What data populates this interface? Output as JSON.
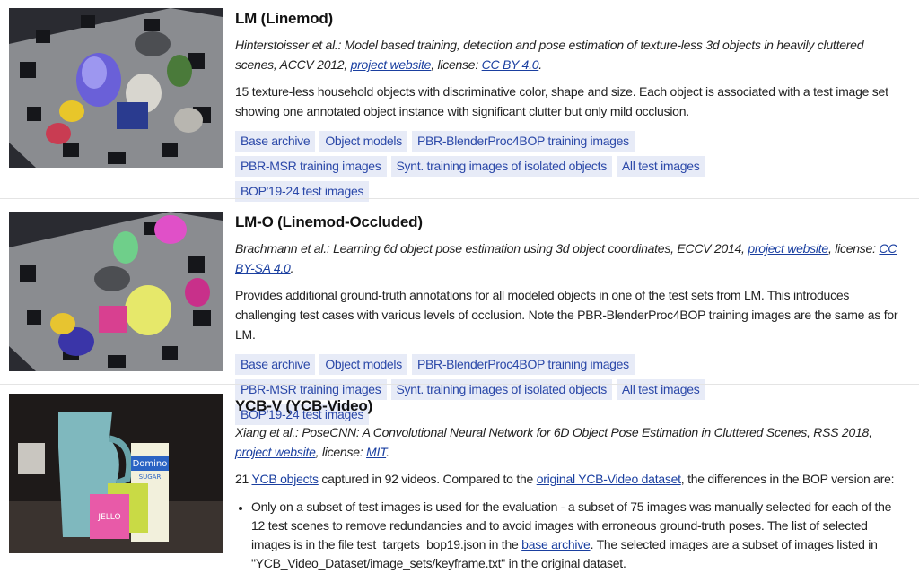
{
  "datasets": [
    {
      "title": "LM (Linemod)",
      "cite_text": "Hinterstoisser et al.: Model based training, detection and pose estimation of texture-less 3d objects in heavily cluttered scenes, ACCV 2012,",
      "website_label": "project website",
      "license_prefix": ", license:",
      "license_label": "CC BY 4.0",
      "cite_end": ".",
      "description": "15 texture-less household objects with discriminative color, shape and size. Each object is associated with a test image set showing one annotated object instance with significant clutter but only mild occlusion.",
      "links": [
        "Base archive",
        "Object models",
        "PBR-BlenderProc4BOP training images",
        "PBR-MSR training images",
        "Synt. training images of isolated objects",
        "All test images",
        "BOP'19-24 test images"
      ]
    },
    {
      "title": "LM-O (Linemod-Occluded)",
      "cite_text": "Brachmann et al.: Learning 6d object pose estimation using 3d object coordinates, ECCV 2014,",
      "website_label": "project website",
      "license_prefix": ", license:",
      "license_label": "CC BY-SA 4.0",
      "cite_end": ".",
      "description": "Provides additional ground-truth annotations for all modeled objects in one of the test sets from LM. This introduces challenging test cases with various levels of occlusion. Note the PBR-BlenderProc4BOP training images are the same as for LM.",
      "links": [
        "Base archive",
        "Object models",
        "PBR-BlenderProc4BOP training images",
        "PBR-MSR training images",
        "Synt. training images of isolated objects",
        "All test images",
        "BOP'19-24 test images"
      ]
    },
    {
      "title": "YCB-V (YCB-Video)",
      "cite_text": "Xiang et al.: PoseCNN: A Convolutional Neural Network for 6D Object Pose Estimation in Cluttered Scenes, RSS 2018,",
      "website_label": "project website",
      "license_prefix": ", license:",
      "license_label": "MIT",
      "cite_end": ".",
      "desc_pre": "21",
      "desc_link1": "YCB objects",
      "desc_mid": "captured in 92 videos. Compared to the",
      "desc_link2": "original YCB-Video dataset",
      "desc_post": ", the differences in the BOP version are:",
      "bullet_pre": "Only on a subset of test images is used for the evaluation - a subset of 75 images was manually selected for each of the 12 test scenes to remove redundancies and to avoid images with erroneous ground-truth poses. The list of selected images is in the file test_targets_bop19.json in the",
      "bullet_link": "base archive",
      "bullet_post": ". The selected images are a subset of images listed in \"YCB_Video_Dataset/image_sets/keyframe.txt\" in the original dataset.",
      "box_label_domino": "Domino",
      "box_label_sugar": "SUGAR",
      "box_label_jello": "JELLO"
    }
  ]
}
